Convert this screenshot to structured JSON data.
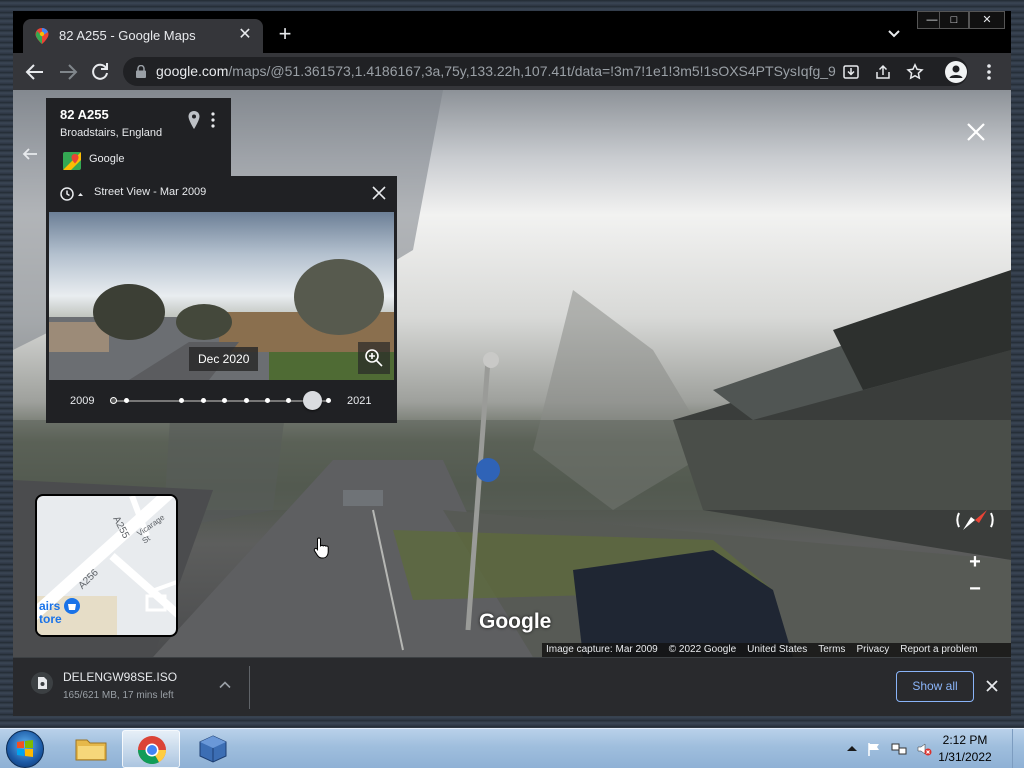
{
  "window": {
    "controls": {
      "minimize": "—",
      "maximize": "□",
      "close": "✕"
    }
  },
  "tab": {
    "title": "82 A255 - Google Maps",
    "close": "✕",
    "new_tab": "+"
  },
  "toolbar": {
    "url_domain": "google.com",
    "url_path": "/maps/@51.361573,1.4186167,3a,75y,133.22h,107.41t/data=!3m7!1e1!3m5!1sOXS4PTSysIqfg_9L..."
  },
  "place_card": {
    "title": "82 A255",
    "subtitle": "Broadstairs, England",
    "source": "Google"
  },
  "history": {
    "title": "Street View - Mar 2009",
    "thumbnail_date": "Dec 2020",
    "start_year": "2009",
    "end_year": "2021",
    "selected_fraction": 0.92
  },
  "minimap": {
    "road_a255": "A255",
    "road_a256": "A256",
    "street_vicarage": "Vicarage St",
    "store_line1": "airs",
    "store_line2": "tore"
  },
  "streetview": {
    "logo": "Google",
    "zoom_in": "+",
    "zoom_out": "−",
    "attribution": {
      "capture": "Image capture: Mar 2009",
      "copyright": "© 2022 Google",
      "country": "United States",
      "terms": "Terms",
      "privacy": "Privacy",
      "report": "Report a problem"
    }
  },
  "downloads": {
    "file_name": "DELENGW98SE.ISO",
    "status": "165/621 MB, 17 mins left",
    "show_all": "Show all"
  },
  "taskbar": {
    "time": "2:12 PM",
    "date": "1/31/2022"
  },
  "colors": {
    "accent_blue": "#8ab4f8",
    "maps_pin_red": "#ea4335",
    "chrome_dark": "#202124",
    "taskbar_blue": "#9fbedd"
  }
}
